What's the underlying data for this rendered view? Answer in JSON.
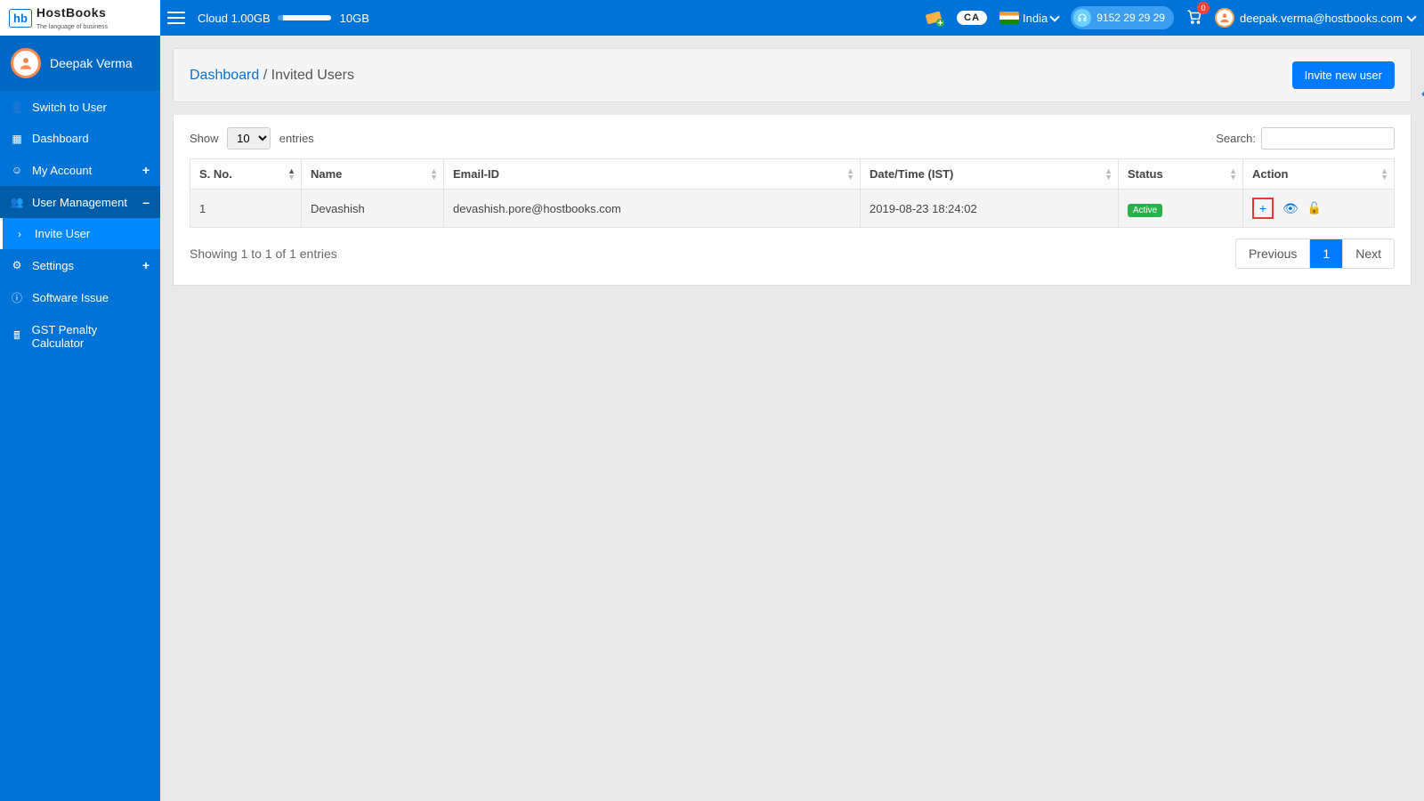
{
  "brand": {
    "short": "hb",
    "title": "HostBooks",
    "subtitle": "The language of business"
  },
  "topbar": {
    "cloud_label": "Cloud 1.00GB",
    "cloud_max": "10GB",
    "country": "India",
    "phone": "9152 29 29 29",
    "cart_count": "0",
    "user_email": "deepak.verma@hostbooks.com"
  },
  "sidebar": {
    "user_name": "Deepak Verma",
    "items": {
      "switch": "Switch to User",
      "dashboard": "Dashboard",
      "account": "My Account",
      "usermgmt": "User Management",
      "invite": "Invite User",
      "settings": "Settings",
      "issue": "Software Issue",
      "gst": "GST Penalty Calculator"
    }
  },
  "page": {
    "bc_root": "Dashboard",
    "bc_sep": " / ",
    "bc_current": "Invited Users",
    "invite_btn": "Invite new user"
  },
  "table": {
    "show_pre": "Show",
    "show_post": "entries",
    "length_value": "10",
    "search_label": "Search:",
    "cols": {
      "sno": "S. No.",
      "name": "Name",
      "email": "Email-ID",
      "dt": "Date/Time (IST)",
      "status": "Status",
      "action": "Action"
    },
    "rows": [
      {
        "sno": "1",
        "name": "Devashish",
        "email": "devashish.pore@hostbooks.com",
        "dt": "2019-08-23 18:24:02",
        "status": "Active"
      }
    ],
    "info": "Showing 1 to 1 of 1 entries",
    "prev": "Previous",
    "page1": "1",
    "next": "Next"
  },
  "ca_badge": "CA"
}
